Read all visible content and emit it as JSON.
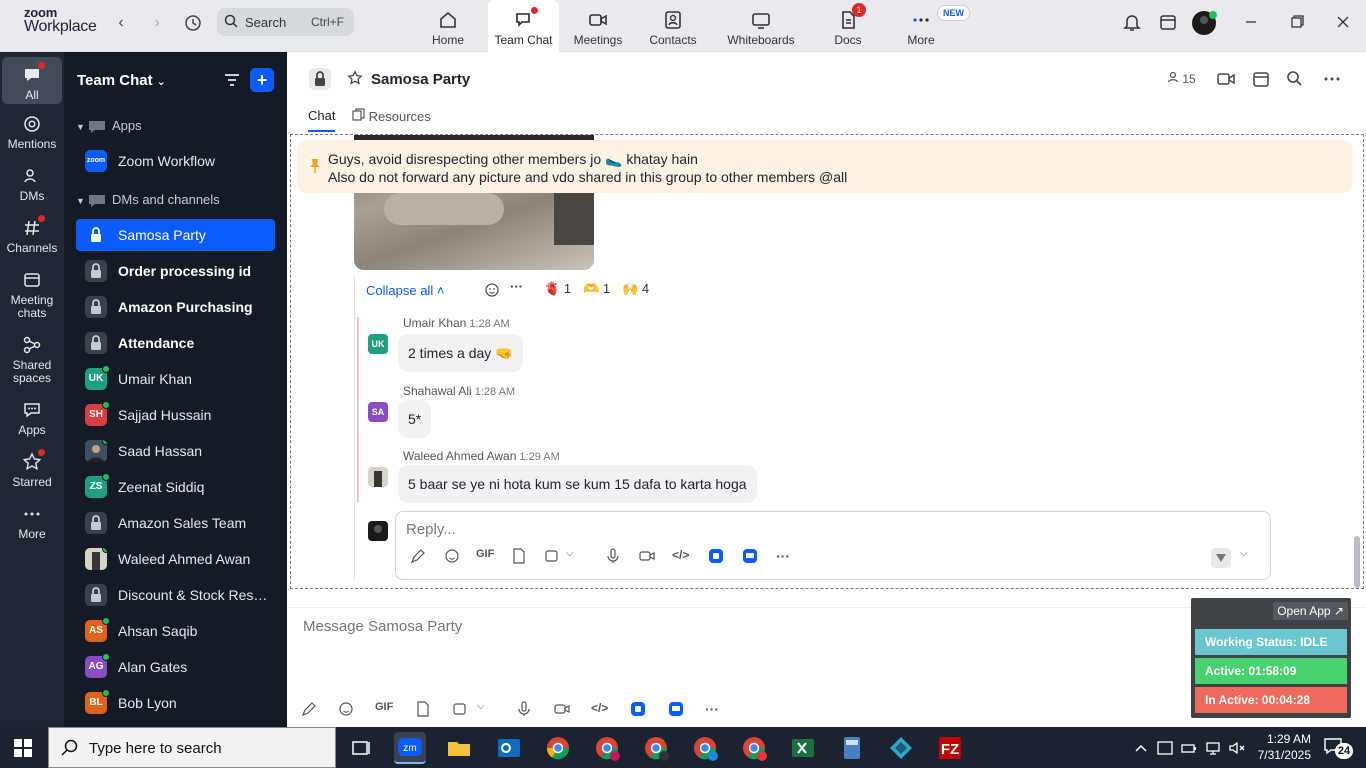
{
  "brand": {
    "line1": "zoom",
    "line2": "Workplace"
  },
  "search": {
    "label": "Search",
    "shortcut": "Ctrl+F"
  },
  "top_tabs": [
    {
      "label": "Home"
    },
    {
      "label": "Team Chat"
    },
    {
      "label": "Meetings"
    },
    {
      "label": "Contacts"
    },
    {
      "label": "Whiteboards"
    },
    {
      "label": "Docs",
      "badge": "1"
    },
    {
      "label": "More",
      "badge": "NEW"
    }
  ],
  "rail": [
    {
      "label": "All"
    },
    {
      "label": "Mentions"
    },
    {
      "label": "DMs"
    },
    {
      "label": "Channels"
    },
    {
      "label": "Meeting chats"
    },
    {
      "label": "Shared spaces"
    },
    {
      "label": "Apps"
    },
    {
      "label": "Starred"
    },
    {
      "label": "More"
    }
  ],
  "sidebar": {
    "title": "Team Chat",
    "sections": {
      "apps": "Apps",
      "dms": "DMs and channels"
    },
    "app_item": {
      "label": "Zoom Workflow",
      "avatar": "zoom"
    },
    "items": [
      {
        "label": "Samosa Party"
      },
      {
        "label": "Order processing id"
      },
      {
        "label": "Amazon Purchasing"
      },
      {
        "label": "Attendance"
      },
      {
        "label": "Umair Khan",
        "initials": "UK",
        "color": "#1f9f7f"
      },
      {
        "label": "Sajjad Hussain",
        "initials": "SH",
        "color": "#d93d3d"
      },
      {
        "label": "Saad Hassan"
      },
      {
        "label": "Zeenat Siddiq",
        "initials": "ZS",
        "color": "#1f9f7f"
      },
      {
        "label": "Amazon Sales Team"
      },
      {
        "label": "Waleed Ahmed Awan"
      },
      {
        "label": "Discount & Stock Reser..."
      },
      {
        "label": "Ahsan Saqib",
        "initials": "AS",
        "color": "#e0631c"
      },
      {
        "label": "Alan Gates",
        "initials": "AG",
        "color": "#8a4cc2"
      },
      {
        "label": "Bob Lyon",
        "initials": "BL",
        "color": "#e0631c"
      }
    ]
  },
  "chat": {
    "title": "Samosa Party",
    "member_count": "15",
    "tabs": {
      "chat": "Chat",
      "resources": "Resources"
    },
    "pinned": {
      "line1": "Guys, avoid disrespecting other members jo 🥿 khatay hain",
      "line2": "Also do not forward any picture and vdo shared in this group to other members @all"
    },
    "collapse_label": "Collapse all",
    "reactions": [
      {
        "emoji": "🫀",
        "count": "1"
      },
      {
        "emoji": "🫶",
        "count": "1"
      },
      {
        "emoji": "🙌",
        "count": "4"
      }
    ],
    "messages": [
      {
        "initials": "UK",
        "color": "#1f9f7f",
        "sender": "Umair Khan",
        "time": "1:28 AM",
        "text": "2 times a day 🤜"
      },
      {
        "initials": "SA",
        "color": "#8a4cc2",
        "sender": "Shahawal Ali",
        "time": "1:28 AM",
        "text": "5*"
      },
      {
        "initials": "",
        "color": "#4a4743",
        "sender": "Waleed Ahmed Awan",
        "time": "1:29 AM",
        "text": "5 baar se ye ni hota kum se kum 15 dafa to karta hoga"
      }
    ],
    "reply_placeholder": "Reply...",
    "composer_placeholder": "Message Samosa Party",
    "gif_label": "GIF"
  },
  "widget": {
    "open_app": "Open App ↗",
    "working_status": "Working Status: IDLE",
    "active": "Active: 01:58:09",
    "inactive": "In Active: 00:04:28",
    "colors": {
      "status": "#6cc6cf",
      "active": "#47d16f",
      "inactive": "#ee6a5a"
    }
  },
  "taskbar": {
    "search_placeholder": "Type here to search",
    "time": "1:29 AM",
    "date": "7/31/2025",
    "notifications": "24"
  },
  "accent": "#0b5cff"
}
